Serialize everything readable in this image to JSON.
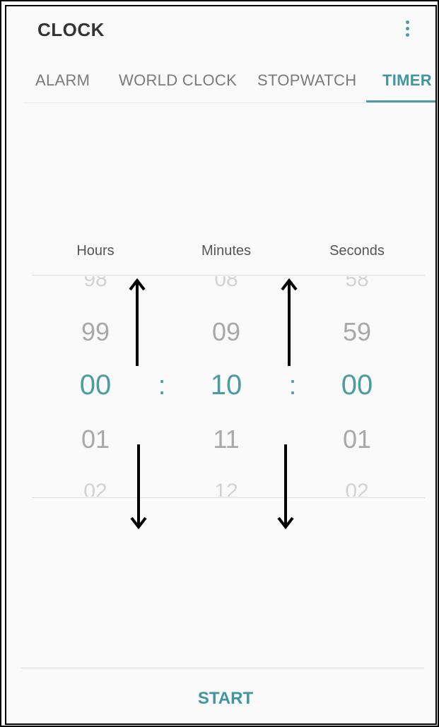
{
  "header": {
    "title": "CLOCK",
    "more_icon": "more-vertical-icon"
  },
  "tabs": [
    {
      "label": "ALARM",
      "active": false
    },
    {
      "label": "WORLD CLOCK",
      "active": false
    },
    {
      "label": "STOPWATCH",
      "active": false
    },
    {
      "label": "TIMER",
      "active": true
    }
  ],
  "timer": {
    "labels": {
      "hours": "Hours",
      "minutes": "Minutes",
      "seconds": "Seconds"
    },
    "hours": {
      "prev2": "98",
      "prev1": "99",
      "selected": "00",
      "next1": "01",
      "next2": "02"
    },
    "minutes": {
      "prev2": "08",
      "prev1": "09",
      "selected": "10",
      "next1": "11",
      "next2": "12"
    },
    "seconds": {
      "prev2": "58",
      "prev1": "59",
      "selected": "00",
      "next1": "01",
      "next2": "02"
    },
    "separator": ":"
  },
  "footer": {
    "start_label": "START"
  },
  "colors": {
    "accent": "#4b9ba2",
    "text_muted": "#a8a8a8",
    "background": "#fafafa"
  }
}
